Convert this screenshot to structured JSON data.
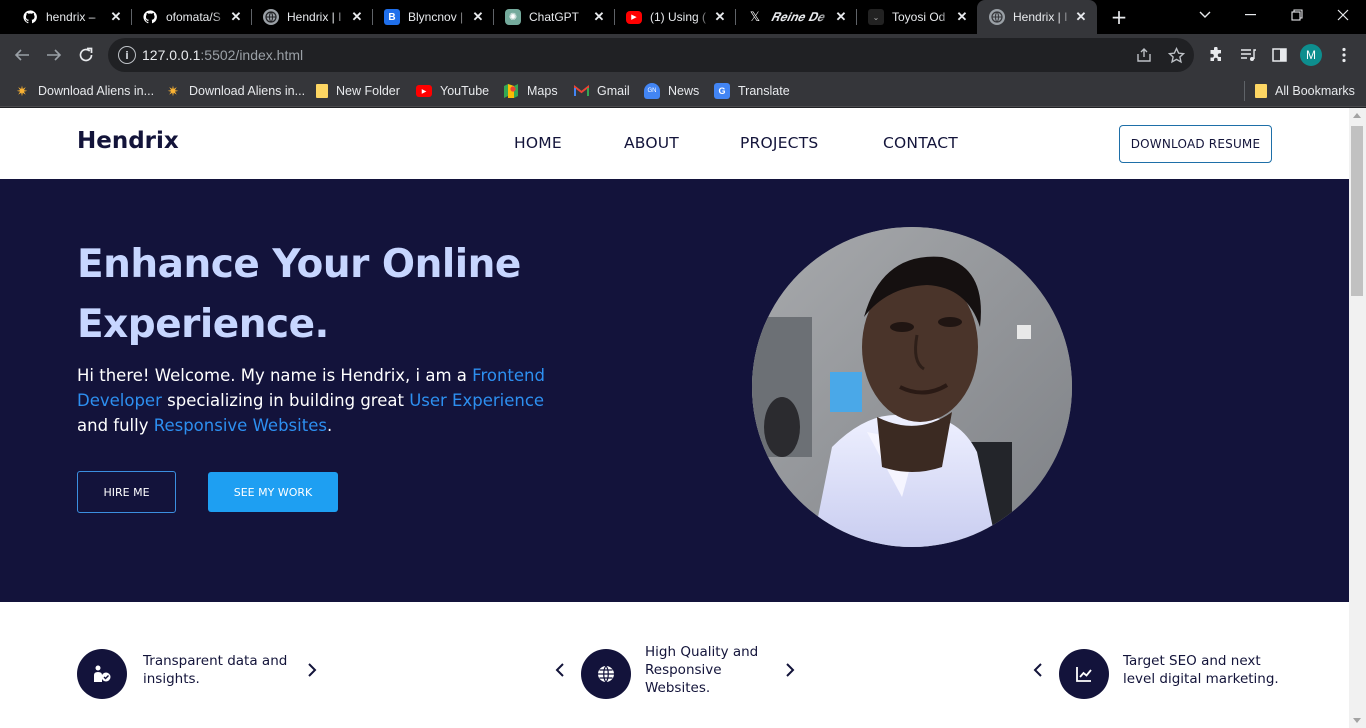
{
  "browser": {
    "tabs": [
      {
        "title": "hendrix –",
        "icon": "github-icon"
      },
      {
        "title": "ofomata/S",
        "icon": "github-icon"
      },
      {
        "title": "Hendrix | I",
        "icon": "globe-icon"
      },
      {
        "title": "Blyncnov |",
        "icon": "blyncnov-icon"
      },
      {
        "title": "ChatGPT",
        "icon": "chatgpt-icon"
      },
      {
        "title": "(1) Using (",
        "icon": "youtube-icon"
      },
      {
        "title": "𝑹𝒆𝒊𝒏𝒆 𝑫𝒆",
        "icon": "x-icon"
      },
      {
        "title": "Toyosi Od",
        "icon": "site-icon"
      },
      {
        "title": "Hendrix | I",
        "icon": "globe-icon",
        "active": true
      }
    ],
    "url_host": "127.0.0.1",
    "url_rest": ":5502/index.html",
    "profile_initial": "M",
    "bookmarks": [
      {
        "label": "Download Aliens in...",
        "icon": "aliens-icon"
      },
      {
        "label": "Download Aliens in...",
        "icon": "aliens-icon"
      },
      {
        "label": "New Folder",
        "icon": "folder-icon"
      },
      {
        "label": "YouTube",
        "icon": "youtube-icon"
      },
      {
        "label": "Maps",
        "icon": "maps-icon"
      },
      {
        "label": "Gmail",
        "icon": "gmail-icon"
      },
      {
        "label": "News",
        "icon": "news-icon"
      },
      {
        "label": "Translate",
        "icon": "translate-icon"
      }
    ],
    "all_bookmarks": "All Bookmarks"
  },
  "site": {
    "logo": "Hendrix",
    "nav": [
      "HOME",
      "ABOUT",
      "PROJECTS",
      "CONTACT"
    ],
    "resume_button": "DOWNLOAD RESUME",
    "hero": {
      "title": "Enhance Your Online Experience.",
      "intro_1": "Hi there! Welcome. My name is Hendrix, i am a ",
      "highlight_1": "Frontend Developer",
      "intro_2": " specializing in building great ",
      "highlight_2": "User Experience",
      "intro_3": " and fully ",
      "highlight_3": "Responsive Websites",
      "intro_4": ".",
      "hire_button": "HIRE ME",
      "work_button": "SEE MY WORK"
    },
    "features": [
      {
        "text": "Transparent data and insights.",
        "icon": "user-check-icon"
      },
      {
        "text": "High Quality and Responsive Websites.",
        "icon": "globe-icon"
      },
      {
        "text": "Target SEO and next level digital marketing.",
        "icon": "chart-line-icon"
      }
    ]
  },
  "colors": {
    "hero_bg": "#13133b",
    "accent": "#1e9ff2",
    "highlight": "#2d8ff0",
    "title": "#c7d6ff"
  }
}
